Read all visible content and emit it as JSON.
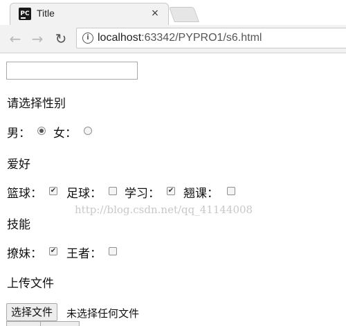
{
  "browser": {
    "tab_title": "Title",
    "tab_close": "×",
    "favicon_text": "PC",
    "url_host": "localhost",
    "url_rest": ":63342/PYPRO1/s6.html",
    "icons": [
      "back-arrow-icon",
      "forward-arrow-icon",
      "reload-icon",
      "info-icon",
      "close-icon"
    ]
  },
  "form": {
    "text_input_value": "",
    "gender": {
      "label": "请选择性别",
      "options": [
        {
          "label": "男：",
          "checked": true
        },
        {
          "label": "女：",
          "checked": false
        }
      ]
    },
    "hobbies": {
      "label": "爱好",
      "options": [
        {
          "label": "篮球：",
          "checked": true
        },
        {
          "label": "足球：",
          "checked": false
        },
        {
          "label": "学习：",
          "checked": true
        },
        {
          "label": "翘课：",
          "checked": false
        }
      ]
    },
    "skills": {
      "label": "技能",
      "options": [
        {
          "label": "撩妹：",
          "checked": true
        },
        {
          "label": "王者：",
          "checked": false
        }
      ]
    },
    "upload": {
      "label": "上传文件",
      "button_label": "选择文件",
      "status": "未选择任何文件"
    }
  },
  "watermark": "http://blog.csdn.net/qq_41144008"
}
